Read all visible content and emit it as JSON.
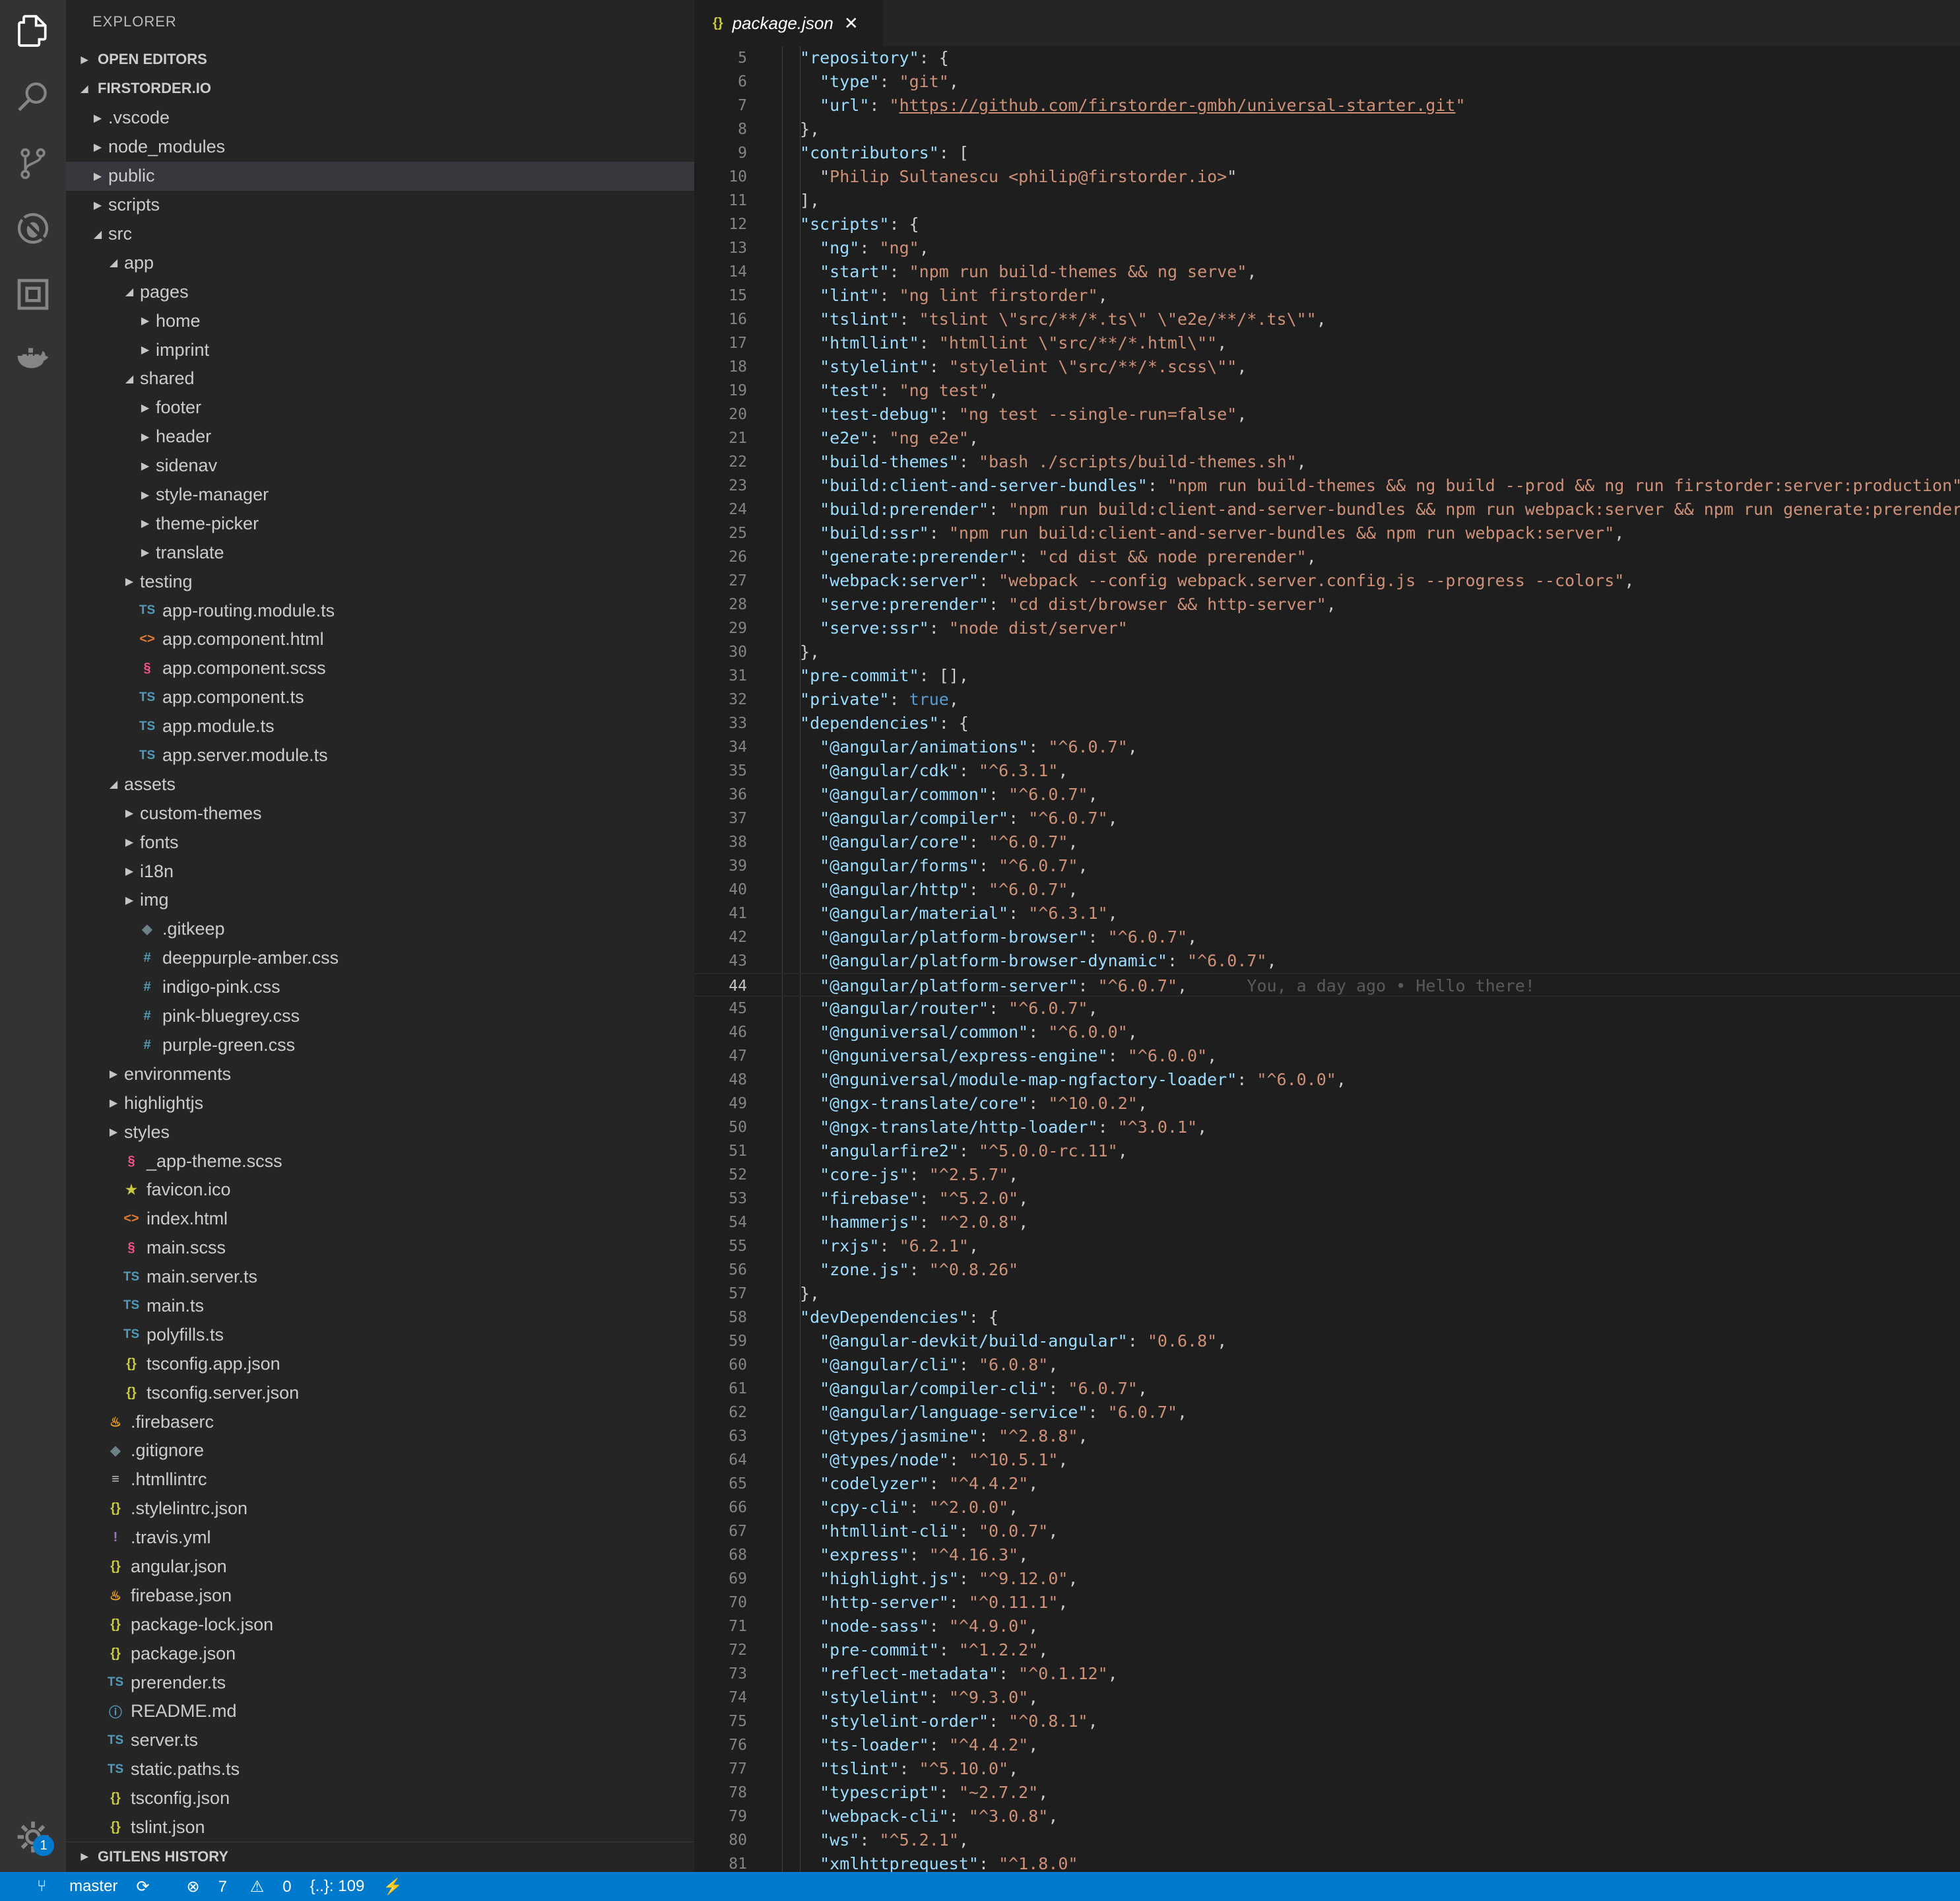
{
  "explorer": {
    "title": "EXPLORER",
    "open_editors_label": "OPEN EDITORS",
    "root_label": "FIRSTORDER.IO",
    "gitlens_label": "GITLENS HISTORY"
  },
  "tree": [
    {
      "label": ".vscode",
      "depth": 0,
      "kind": "folder",
      "expanded": false
    },
    {
      "label": "node_modules",
      "depth": 0,
      "kind": "folder",
      "expanded": false
    },
    {
      "label": "public",
      "depth": 0,
      "kind": "folder",
      "expanded": false,
      "selected": true
    },
    {
      "label": "scripts",
      "depth": 0,
      "kind": "folder",
      "expanded": false
    },
    {
      "label": "src",
      "depth": 0,
      "kind": "folder",
      "expanded": true
    },
    {
      "label": "app",
      "depth": 1,
      "kind": "folder",
      "expanded": true
    },
    {
      "label": "pages",
      "depth": 2,
      "kind": "folder",
      "expanded": true
    },
    {
      "label": "home",
      "depth": 3,
      "kind": "folder",
      "expanded": false
    },
    {
      "label": "imprint",
      "depth": 3,
      "kind": "folder",
      "expanded": false
    },
    {
      "label": "shared",
      "depth": 2,
      "kind": "folder",
      "expanded": true
    },
    {
      "label": "footer",
      "depth": 3,
      "kind": "folder",
      "expanded": false
    },
    {
      "label": "header",
      "depth": 3,
      "kind": "folder",
      "expanded": false
    },
    {
      "label": "sidenav",
      "depth": 3,
      "kind": "folder",
      "expanded": false
    },
    {
      "label": "style-manager",
      "depth": 3,
      "kind": "folder",
      "expanded": false
    },
    {
      "label": "theme-picker",
      "depth": 3,
      "kind": "folder",
      "expanded": false
    },
    {
      "label": "translate",
      "depth": 3,
      "kind": "folder",
      "expanded": false
    },
    {
      "label": "testing",
      "depth": 2,
      "kind": "folder",
      "expanded": false
    },
    {
      "label": "app-routing.module.ts",
      "depth": 2,
      "kind": "ts"
    },
    {
      "label": "app.component.html",
      "depth": 2,
      "kind": "html"
    },
    {
      "label": "app.component.scss",
      "depth": 2,
      "kind": "scss"
    },
    {
      "label": "app.component.ts",
      "depth": 2,
      "kind": "ts"
    },
    {
      "label": "app.module.ts",
      "depth": 2,
      "kind": "ts"
    },
    {
      "label": "app.server.module.ts",
      "depth": 2,
      "kind": "ts"
    },
    {
      "label": "assets",
      "depth": 1,
      "kind": "folder",
      "expanded": true
    },
    {
      "label": "custom-themes",
      "depth": 2,
      "kind": "folder",
      "expanded": false
    },
    {
      "label": "fonts",
      "depth": 2,
      "kind": "folder",
      "expanded": false
    },
    {
      "label": "i18n",
      "depth": 2,
      "kind": "folder",
      "expanded": false
    },
    {
      "label": "img",
      "depth": 2,
      "kind": "folder",
      "expanded": false
    },
    {
      "label": ".gitkeep",
      "depth": 2,
      "kind": "git"
    },
    {
      "label": "deeppurple-amber.css",
      "depth": 2,
      "kind": "css"
    },
    {
      "label": "indigo-pink.css",
      "depth": 2,
      "kind": "css"
    },
    {
      "label": "pink-bluegrey.css",
      "depth": 2,
      "kind": "css"
    },
    {
      "label": "purple-green.css",
      "depth": 2,
      "kind": "css"
    },
    {
      "label": "environments",
      "depth": 1,
      "kind": "folder",
      "expanded": false
    },
    {
      "label": "highlightjs",
      "depth": 1,
      "kind": "folder",
      "expanded": false
    },
    {
      "label": "styles",
      "depth": 1,
      "kind": "folder",
      "expanded": false
    },
    {
      "label": "_app-theme.scss",
      "depth": 1,
      "kind": "scss"
    },
    {
      "label": "favicon.ico",
      "depth": 1,
      "kind": "star"
    },
    {
      "label": "index.html",
      "depth": 1,
      "kind": "html"
    },
    {
      "label": "main.scss",
      "depth": 1,
      "kind": "scss"
    },
    {
      "label": "main.server.ts",
      "depth": 1,
      "kind": "ts"
    },
    {
      "label": "main.ts",
      "depth": 1,
      "kind": "ts"
    },
    {
      "label": "polyfills.ts",
      "depth": 1,
      "kind": "ts"
    },
    {
      "label": "tsconfig.app.json",
      "depth": 1,
      "kind": "json"
    },
    {
      "label": "tsconfig.server.json",
      "depth": 1,
      "kind": "json"
    },
    {
      "label": ".firebaserc",
      "depth": 0,
      "kind": "fire"
    },
    {
      "label": ".gitignore",
      "depth": 0,
      "kind": "git"
    },
    {
      "label": ".htmllintrc",
      "depth": 0,
      "kind": "lines"
    },
    {
      "label": ".stylelintrc.json",
      "depth": 0,
      "kind": "json"
    },
    {
      "label": ".travis.yml",
      "depth": 0,
      "kind": "yml"
    },
    {
      "label": "angular.json",
      "depth": 0,
      "kind": "json"
    },
    {
      "label": "firebase.json",
      "depth": 0,
      "kind": "fire"
    },
    {
      "label": "package-lock.json",
      "depth": 0,
      "kind": "json"
    },
    {
      "label": "package.json",
      "depth": 0,
      "kind": "json"
    },
    {
      "label": "prerender.ts",
      "depth": 0,
      "kind": "ts"
    },
    {
      "label": "README.md",
      "depth": 0,
      "kind": "info"
    },
    {
      "label": "server.ts",
      "depth": 0,
      "kind": "ts"
    },
    {
      "label": "static.paths.ts",
      "depth": 0,
      "kind": "ts"
    },
    {
      "label": "tsconfig.json",
      "depth": 0,
      "kind": "json"
    },
    {
      "label": "tslint.json",
      "depth": 0,
      "kind": "json"
    }
  ],
  "icons": {
    "ts": "TS",
    "html": "<>",
    "scss": "§",
    "json": "{}",
    "css": "#",
    "git": "◆",
    "fire": "♨",
    "star": "★",
    "yml": "!",
    "info": "ⓘ",
    "lines": "≡"
  },
  "tab": {
    "title": "package.json",
    "icon": "{}",
    "close": "✕"
  },
  "current_line": 44,
  "blame": "You, a day ago • Hello there!",
  "code_lines": [
    {
      "n": 5,
      "indent": 1,
      "key": "repository",
      "tail": ": {"
    },
    {
      "n": 6,
      "indent": 2,
      "key": "type",
      "val": "git",
      "tail": ","
    },
    {
      "n": 7,
      "indent": 2,
      "key": "url",
      "val": "https://github.com/firstorder-gmbh/universal-starter.git",
      "link": true
    },
    {
      "n": 8,
      "indent": 1,
      "raw": "},"
    },
    {
      "n": 9,
      "indent": 1,
      "key": "contributors",
      "tail": ": ["
    },
    {
      "n": 10,
      "indent": 2,
      "str": "Philip Sultanescu <philip@firstorder.io>"
    },
    {
      "n": 11,
      "indent": 1,
      "raw": "],"
    },
    {
      "n": 12,
      "indent": 1,
      "key": "scripts",
      "tail": ": {"
    },
    {
      "n": 13,
      "indent": 2,
      "key": "ng",
      "val": "ng",
      "tail": ","
    },
    {
      "n": 14,
      "indent": 2,
      "key": "start",
      "val": "npm run build-themes && ng serve",
      "tail": ","
    },
    {
      "n": 15,
      "indent": 2,
      "key": "lint",
      "val": "ng lint firstorder",
      "tail": ","
    },
    {
      "n": 16,
      "indent": 2,
      "key": "tslint",
      "val": "tslint \\\"src/**/*.ts\\\" \\\"e2e/**/*.ts\\\"",
      "tail": ","
    },
    {
      "n": 17,
      "indent": 2,
      "key": "htmllint",
      "val": "htmllint \\\"src/**/*.html\\\"",
      "tail": ","
    },
    {
      "n": 18,
      "indent": 2,
      "key": "stylelint",
      "val": "stylelint \\\"src/**/*.scss\\\"",
      "tail": ","
    },
    {
      "n": 19,
      "indent": 2,
      "key": "test",
      "val": "ng test",
      "tail": ","
    },
    {
      "n": 20,
      "indent": 2,
      "key": "test-debug",
      "val": "ng test --single-run=false",
      "tail": ","
    },
    {
      "n": 21,
      "indent": 2,
      "key": "e2e",
      "val": "ng e2e",
      "tail": ","
    },
    {
      "n": 22,
      "indent": 2,
      "key": "build-themes",
      "val": "bash ./scripts/build-themes.sh",
      "tail": ","
    },
    {
      "n": 23,
      "indent": 2,
      "key": "build:client-and-server-bundles",
      "val": "npm run build-themes && ng build --prod && ng run firstorder:server:production",
      "tail": ","
    },
    {
      "n": 24,
      "indent": 2,
      "key": "build:prerender",
      "val": "npm run build:client-and-server-bundles && npm run webpack:server && npm run generate:prerender",
      "tail": ","
    },
    {
      "n": 25,
      "indent": 2,
      "key": "build:ssr",
      "val": "npm run build:client-and-server-bundles && npm run webpack:server",
      "tail": ","
    },
    {
      "n": 26,
      "indent": 2,
      "key": "generate:prerender",
      "val": "cd dist && node prerender",
      "tail": ","
    },
    {
      "n": 27,
      "indent": 2,
      "key": "webpack:server",
      "val": "webpack --config webpack.server.config.js --progress --colors",
      "tail": ","
    },
    {
      "n": 28,
      "indent": 2,
      "key": "serve:prerender",
      "val": "cd dist/browser && http-server",
      "tail": ","
    },
    {
      "n": 29,
      "indent": 2,
      "key": "serve:ssr",
      "val": "node dist/server"
    },
    {
      "n": 30,
      "indent": 1,
      "raw": "},"
    },
    {
      "n": 31,
      "indent": 1,
      "key": "pre-commit",
      "tail": ": [],"
    },
    {
      "n": 32,
      "indent": 1,
      "key": "private",
      "bool": "true",
      "tail": ","
    },
    {
      "n": 33,
      "indent": 1,
      "key": "dependencies",
      "tail": ": {"
    },
    {
      "n": 34,
      "indent": 2,
      "key": "@angular/animations",
      "val": "^6.0.7",
      "tail": ","
    },
    {
      "n": 35,
      "indent": 2,
      "key": "@angular/cdk",
      "val": "^6.3.1",
      "tail": ","
    },
    {
      "n": 36,
      "indent": 2,
      "key": "@angular/common",
      "val": "^6.0.7",
      "tail": ","
    },
    {
      "n": 37,
      "indent": 2,
      "key": "@angular/compiler",
      "val": "^6.0.7",
      "tail": ","
    },
    {
      "n": 38,
      "indent": 2,
      "key": "@angular/core",
      "val": "^6.0.7",
      "tail": ","
    },
    {
      "n": 39,
      "indent": 2,
      "key": "@angular/forms",
      "val": "^6.0.7",
      "tail": ","
    },
    {
      "n": 40,
      "indent": 2,
      "key": "@angular/http",
      "val": "^6.0.7",
      "tail": ","
    },
    {
      "n": 41,
      "indent": 2,
      "key": "@angular/material",
      "val": "^6.3.1",
      "tail": ","
    },
    {
      "n": 42,
      "indent": 2,
      "key": "@angular/platform-browser",
      "val": "^6.0.7",
      "tail": ","
    },
    {
      "n": 43,
      "indent": 2,
      "key": "@angular/platform-browser-dynamic",
      "val": "^6.0.7",
      "tail": ","
    },
    {
      "n": 44,
      "indent": 2,
      "key": "@angular/platform-server",
      "val": "^6.0.7",
      "tail": ","
    },
    {
      "n": 45,
      "indent": 2,
      "key": "@angular/router",
      "val": "^6.0.7",
      "tail": ","
    },
    {
      "n": 46,
      "indent": 2,
      "key": "@nguniversal/common",
      "val": "^6.0.0",
      "tail": ","
    },
    {
      "n": 47,
      "indent": 2,
      "key": "@nguniversal/express-engine",
      "val": "^6.0.0",
      "tail": ","
    },
    {
      "n": 48,
      "indent": 2,
      "key": "@nguniversal/module-map-ngfactory-loader",
      "val": "^6.0.0",
      "tail": ","
    },
    {
      "n": 49,
      "indent": 2,
      "key": "@ngx-translate/core",
      "val": "^10.0.2",
      "tail": ","
    },
    {
      "n": 50,
      "indent": 2,
      "key": "@ngx-translate/http-loader",
      "val": "^3.0.1",
      "tail": ","
    },
    {
      "n": 51,
      "indent": 2,
      "key": "angularfire2",
      "val": "^5.0.0-rc.11",
      "tail": ","
    },
    {
      "n": 52,
      "indent": 2,
      "key": "core-js",
      "val": "^2.5.7",
      "tail": ","
    },
    {
      "n": 53,
      "indent": 2,
      "key": "firebase",
      "val": "^5.2.0",
      "tail": ","
    },
    {
      "n": 54,
      "indent": 2,
      "key": "hammerjs",
      "val": "^2.0.8",
      "tail": ","
    },
    {
      "n": 55,
      "indent": 2,
      "key": "rxjs",
      "val": "6.2.1",
      "tail": ","
    },
    {
      "n": 56,
      "indent": 2,
      "key": "zone.js",
      "val": "^0.8.26"
    },
    {
      "n": 57,
      "indent": 1,
      "raw": "},"
    },
    {
      "n": 58,
      "indent": 1,
      "key": "devDependencies",
      "tail": ": {"
    },
    {
      "n": 59,
      "indent": 2,
      "key": "@angular-devkit/build-angular",
      "val": "0.6.8",
      "tail": ","
    },
    {
      "n": 60,
      "indent": 2,
      "key": "@angular/cli",
      "val": "6.0.8",
      "tail": ","
    },
    {
      "n": 61,
      "indent": 2,
      "key": "@angular/compiler-cli",
      "val": "6.0.7",
      "tail": ","
    },
    {
      "n": 62,
      "indent": 2,
      "key": "@angular/language-service",
      "val": "6.0.7",
      "tail": ","
    },
    {
      "n": 63,
      "indent": 2,
      "key": "@types/jasmine",
      "val": "^2.8.8",
      "tail": ","
    },
    {
      "n": 64,
      "indent": 2,
      "key": "@types/node",
      "val": "^10.5.1",
      "tail": ","
    },
    {
      "n": 65,
      "indent": 2,
      "key": "codelyzer",
      "val": "^4.4.2",
      "tail": ","
    },
    {
      "n": 66,
      "indent": 2,
      "key": "cpy-cli",
      "val": "^2.0.0",
      "tail": ","
    },
    {
      "n": 67,
      "indent": 2,
      "key": "htmllint-cli",
      "val": "0.0.7",
      "tail": ","
    },
    {
      "n": 68,
      "indent": 2,
      "key": "express",
      "val": "^4.16.3",
      "tail": ","
    },
    {
      "n": 69,
      "indent": 2,
      "key": "highlight.js",
      "val": "^9.12.0",
      "tail": ","
    },
    {
      "n": 70,
      "indent": 2,
      "key": "http-server",
      "val": "^0.11.1",
      "tail": ","
    },
    {
      "n": 71,
      "indent": 2,
      "key": "node-sass",
      "val": "^4.9.0",
      "tail": ","
    },
    {
      "n": 72,
      "indent": 2,
      "key": "pre-commit",
      "val": "^1.2.2",
      "tail": ","
    },
    {
      "n": 73,
      "indent": 2,
      "key": "reflect-metadata",
      "val": "^0.1.12",
      "tail": ","
    },
    {
      "n": 74,
      "indent": 2,
      "key": "stylelint",
      "val": "^9.3.0",
      "tail": ","
    },
    {
      "n": 75,
      "indent": 2,
      "key": "stylelint-order",
      "val": "^0.8.1",
      "tail": ","
    },
    {
      "n": 76,
      "indent": 2,
      "key": "ts-loader",
      "val": "^4.4.2",
      "tail": ","
    },
    {
      "n": 77,
      "indent": 2,
      "key": "tslint",
      "val": "^5.10.0",
      "tail": ","
    },
    {
      "n": 78,
      "indent": 2,
      "key": "typescript",
      "val": "~2.7.2",
      "tail": ","
    },
    {
      "n": 79,
      "indent": 2,
      "key": "webpack-cli",
      "val": "^3.0.8",
      "tail": ","
    },
    {
      "n": 80,
      "indent": 2,
      "key": "ws",
      "val": "^5.2.1",
      "tail": ","
    },
    {
      "n": 81,
      "indent": 2,
      "key": "xmlhttprequest",
      "val": "^1.8.0"
    }
  ],
  "status": {
    "branch": "master",
    "errors": "7",
    "warnings": "0",
    "json_count": "{..}: 109",
    "badge": "1"
  },
  "colors": {
    "activity_bar": "#333333",
    "sidebar": "#252526",
    "editor": "#1e1e1e",
    "status_bar": "#007acc",
    "json_key": "#9cdcfe",
    "json_string": "#ce9178",
    "json_keyword": "#569cd6"
  }
}
